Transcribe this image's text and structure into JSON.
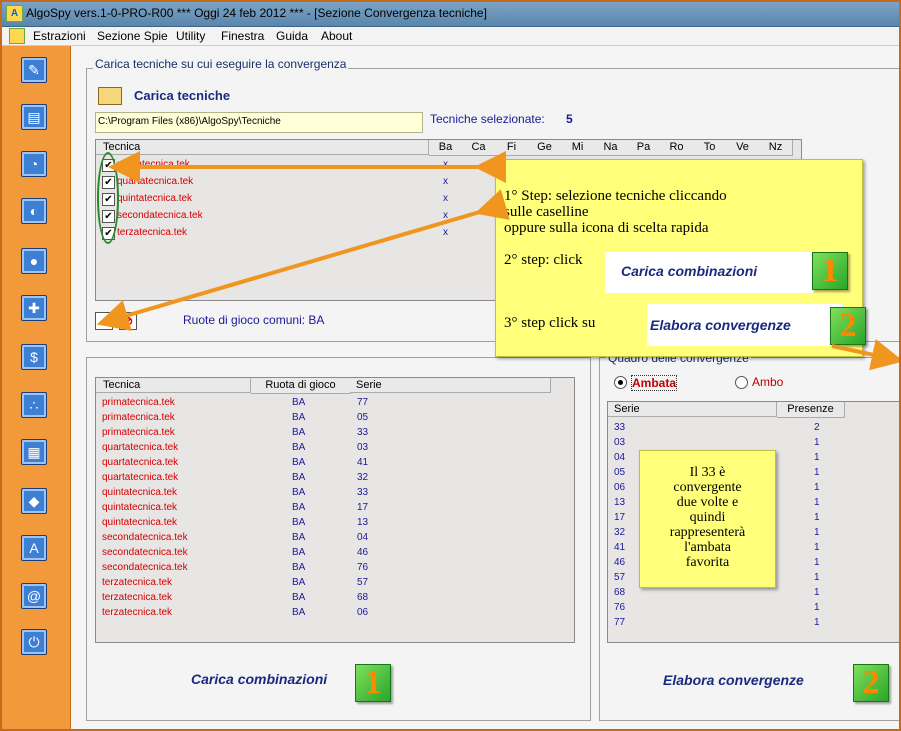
{
  "window": {
    "title": "AlgoSpy vers.1-0-PRO-R00  ***  Oggi 24 feb 2012  ***  - [Sezione Convergenza tecniche]"
  },
  "menu": [
    "Estrazioni",
    "Sezione Spie",
    "Utility",
    "Finestra",
    "Guida",
    "About"
  ],
  "sidebar_icons": [
    "pencil-icon",
    "book-icon",
    "clock-icon",
    "flashlight-icon",
    "lightbulb-icon",
    "lottery-icon",
    "dollar-icon",
    "triangle-balls-icon",
    "calendar-icon",
    "shape-icon",
    "letter-a-icon",
    "contact-icon",
    "power-icon"
  ],
  "top_section": {
    "group_title": "Carica tecniche su cui eseguire la convergenza",
    "load_label": "Carica tecniche",
    "path": "C:\\Program Files (x86)\\AlgoSpy\\Tecniche",
    "selected_label": "Tecniche selezionate:",
    "selected_count": "5",
    "columns": [
      "Tecnica",
      "Ba",
      "Ca",
      "Fi",
      "Ge",
      "Mi",
      "Na",
      "Pa",
      "Ro",
      "To",
      "Ve",
      "Nz"
    ],
    "techniques": [
      {
        "name": "primatecnica.tek",
        "ba": "x"
      },
      {
        "name": "quartatecnica.tek",
        "ba": "x"
      },
      {
        "name": "quintatecnica.tek",
        "ba": "x"
      },
      {
        "name": "secondatecnica.tek",
        "ba": "x"
      },
      {
        "name": "terzatecnica.tek",
        "ba": "x"
      }
    ],
    "common_wheels": "Ruote di gioco comuni: BA",
    "check_all": "✓"
  },
  "combinations": {
    "columns": [
      "Tecnica",
      "Ruota di gioco",
      "Serie"
    ],
    "rows": [
      [
        "primatecnica.tek",
        "BA",
        "77"
      ],
      [
        "primatecnica.tek",
        "BA",
        "05"
      ],
      [
        "primatecnica.tek",
        "BA",
        "33"
      ],
      [
        "quartatecnica.tek",
        "BA",
        "03"
      ],
      [
        "quartatecnica.tek",
        "BA",
        "41"
      ],
      [
        "quartatecnica.tek",
        "BA",
        "32"
      ],
      [
        "quintatecnica.tek",
        "BA",
        "33"
      ],
      [
        "quintatecnica.tek",
        "BA",
        "17"
      ],
      [
        "quintatecnica.tek",
        "BA",
        "13"
      ],
      [
        "secondatecnica.tek",
        "BA",
        "04"
      ],
      [
        "secondatecnica.tek",
        "BA",
        "46"
      ],
      [
        "secondatecnica.tek",
        "BA",
        "76"
      ],
      [
        "terzatecnica.tek",
        "BA",
        "57"
      ],
      [
        "terzatecnica.tek",
        "BA",
        "68"
      ],
      [
        "terzatecnica.tek",
        "BA",
        "06"
      ]
    ],
    "button_label": "Carica combinazioni",
    "badge": "1"
  },
  "convergence": {
    "group_title": "Quadro delle convergenze",
    "radio_ambata": "Ambata",
    "radio_ambo": "Ambo",
    "columns": [
      "Serie",
      "Presenze"
    ],
    "rows": [
      [
        "33",
        "2"
      ],
      [
        "03",
        "1"
      ],
      [
        "04",
        "1"
      ],
      [
        "05",
        "1"
      ],
      [
        "06",
        "1"
      ],
      [
        "13",
        "1"
      ],
      [
        "17",
        "1"
      ],
      [
        "32",
        "1"
      ],
      [
        "41",
        "1"
      ],
      [
        "46",
        "1"
      ],
      [
        "57",
        "1"
      ],
      [
        "68",
        "1"
      ],
      [
        "76",
        "1"
      ],
      [
        "77",
        "1"
      ]
    ],
    "button_label": "Elabora convergenze",
    "badge": "2"
  },
  "notes": {
    "step1_line1": "1° Step: selezione tecniche cliccando",
    "step1_line2": "sulle caselline",
    "step1_line3": "oppure sulla icona di scelta rapida",
    "step2": "2° step: click",
    "step2_btn": "Carica combinazioni",
    "step2_badge": "1",
    "step3": "3° step click su",
    "step3_btn": "Elabora convergenze",
    "step3_badge": "2",
    "explain": [
      "Il 33 è",
      "convergente",
      "due volte e",
      "quindi",
      "rappresenterà",
      "l'ambata",
      "favorita"
    ]
  }
}
